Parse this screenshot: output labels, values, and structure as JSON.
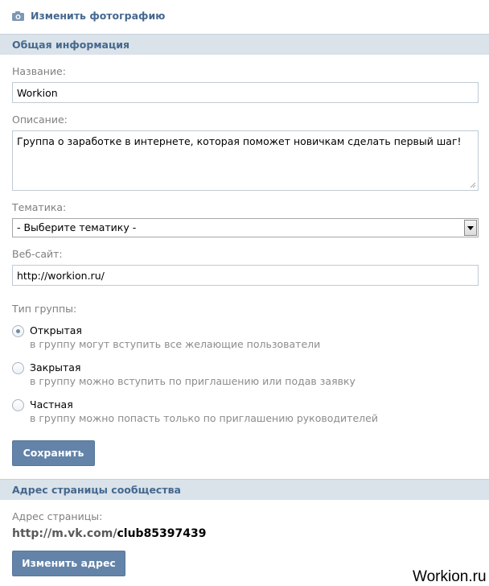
{
  "change_photo": {
    "label": "Изменить фотографию"
  },
  "general_section": {
    "title": "Общая информация"
  },
  "name": {
    "label": "Название:",
    "value": "Workion"
  },
  "description": {
    "label": "Описание:",
    "value": "Группа о заработке в интернете, которая поможет новичкам сделать первый шаг!"
  },
  "topic": {
    "label": "Тематика:",
    "selected": "- Выберите тематику -"
  },
  "website": {
    "label": "Веб-сайт:",
    "value": "http://workion.ru/"
  },
  "group_type": {
    "label": "Тип группы:",
    "options": [
      {
        "title": "Открытая",
        "desc": "в группу могут вступить все желающие пользователи",
        "checked": true
      },
      {
        "title": "Закрытая",
        "desc": "в группу можно вступить по приглашению или подав заявку",
        "checked": false
      },
      {
        "title": "Частная",
        "desc": "в группу можно попасть только по приглашению руководителей",
        "checked": false
      }
    ]
  },
  "save_button": {
    "label": "Сохранить"
  },
  "address_section": {
    "title": "Адрес страницы сообщества"
  },
  "address": {
    "label": "Адрес страницы:",
    "prefix": "http://m.vk.com/",
    "id": "club85397439"
  },
  "change_address_button": {
    "label": "Изменить адрес"
  },
  "watermark": {
    "text": "Workion.ru"
  },
  "colors": {
    "accent": "#45688e",
    "header_bg": "#dae2ea",
    "button_bg": "#6383a8"
  }
}
